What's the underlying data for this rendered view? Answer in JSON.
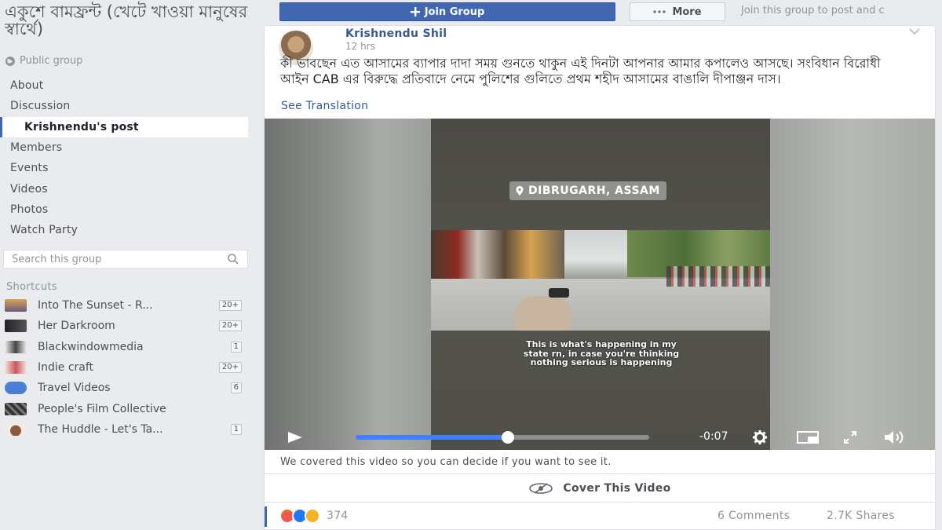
{
  "group": {
    "title": "একুশে বামফ্রন্ট (খেটে খাওয়া মানুষের স্বার্থে)",
    "privacy": "Public group"
  },
  "nav": {
    "items": [
      {
        "label": "About"
      },
      {
        "label": "Discussion"
      },
      {
        "label": "Krishnendu's post",
        "active": true
      },
      {
        "label": "Members"
      },
      {
        "label": "Events"
      },
      {
        "label": "Videos"
      },
      {
        "label": "Photos"
      },
      {
        "label": "Watch Party"
      }
    ]
  },
  "search": {
    "placeholder": "Search this group"
  },
  "shortcuts": {
    "title": "Shortcuts",
    "items": [
      {
        "label": "Into The Sunset - R...",
        "badge": "20+",
        "icon": "sunset-thumb"
      },
      {
        "label": "Her Darkroom",
        "badge": "20+",
        "icon": "darkroom-thumb"
      },
      {
        "label": "Blackwindowmedia",
        "badge": "1",
        "icon": "blackwindow-thumb"
      },
      {
        "label": "Indie craft",
        "badge": "20+",
        "icon": "indie-craft-thumb"
      },
      {
        "label": "Travel Videos",
        "badge": "6",
        "icon": "travel-thumb"
      },
      {
        "label": "People's Film Collective",
        "badge": "",
        "icon": "clapperboard-thumb"
      },
      {
        "label": "The Huddle - Let's Ta...",
        "badge": "1",
        "icon": "coffee-cup-thumb"
      }
    ]
  },
  "topbar": {
    "join_label": "Join Group",
    "more_label": "More",
    "hint": "Join this group to post and c"
  },
  "post": {
    "author": "Krishnendu Shil",
    "time": "12 hrs",
    "text": "কী ভাবছেন এত আসামের ব্যাপার দাদা সময় গুনতে থাকুন এই দিনটা আপনার আমার কপালেও আসছে। সংবিধান বিরোধী আইন CAB এর বিরুদ্ধে প্রতিবাদে নেমে পুলিশের গুলিতে প্রথম শহীদ আসামের বাঙালি দীপাঞ্জন দাস।",
    "see_translation": "See Translation"
  },
  "video": {
    "location": "DIBRUGARH, ASSAM",
    "caption": "This is what's happening in my state rn, in case you're thinking nothing serious is happening",
    "time_left": "-0:07",
    "progress": 0.52,
    "covered_note": "We covered this video so you can decide if you want to see it.",
    "cover_label": "Cover This Video"
  },
  "stats": {
    "reactions": "374",
    "comments": "6 Comments",
    "shares": "2.7K Shares"
  },
  "colors": {
    "brand": "#4267b2",
    "link": "#365899",
    "progress": "#4080ff"
  }
}
